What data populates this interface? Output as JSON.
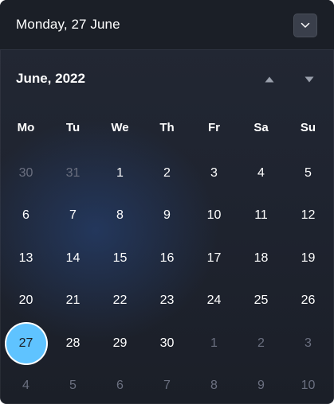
{
  "header": {
    "date_text": "Monday, 27 June"
  },
  "calendar": {
    "month_label": "June, 2022",
    "weekdays": [
      "Mo",
      "Tu",
      "We",
      "Th",
      "Fr",
      "Sa",
      "Su"
    ],
    "days": [
      {
        "label": "30",
        "muted": true
      },
      {
        "label": "31",
        "muted": true
      },
      {
        "label": "1"
      },
      {
        "label": "2"
      },
      {
        "label": "3"
      },
      {
        "label": "4"
      },
      {
        "label": "5"
      },
      {
        "label": "6"
      },
      {
        "label": "7"
      },
      {
        "label": "8"
      },
      {
        "label": "9"
      },
      {
        "label": "10"
      },
      {
        "label": "11"
      },
      {
        "label": "12"
      },
      {
        "label": "13"
      },
      {
        "label": "14"
      },
      {
        "label": "15"
      },
      {
        "label": "16"
      },
      {
        "label": "17"
      },
      {
        "label": "18"
      },
      {
        "label": "19"
      },
      {
        "label": "20"
      },
      {
        "label": "21"
      },
      {
        "label": "22"
      },
      {
        "label": "23"
      },
      {
        "label": "24"
      },
      {
        "label": "25"
      },
      {
        "label": "26"
      },
      {
        "label": "27",
        "selected": true
      },
      {
        "label": "28"
      },
      {
        "label": "29"
      },
      {
        "label": "30"
      },
      {
        "label": "1",
        "muted": true
      },
      {
        "label": "2",
        "muted": true
      },
      {
        "label": "3",
        "muted": true
      },
      {
        "label": "4",
        "muted": true
      },
      {
        "label": "5",
        "muted": true
      },
      {
        "label": "6",
        "muted": true
      },
      {
        "label": "7",
        "muted": true
      },
      {
        "label": "8",
        "muted": true
      },
      {
        "label": "9",
        "muted": true
      },
      {
        "label": "10",
        "muted": true
      }
    ]
  },
  "icons": {
    "collapse": "chevron-down-icon",
    "prev_month": "triangle-up-icon",
    "next_month": "triangle-down-icon"
  },
  "colors": {
    "accent": "#5fc3ff",
    "muted_text": "#6b7080",
    "background": "#1f2430"
  }
}
